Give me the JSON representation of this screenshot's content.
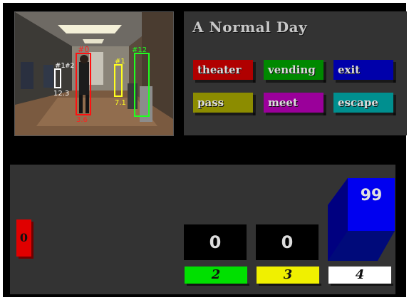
{
  "video": {
    "track_labels": [
      "#0",
      "#1",
      "#2",
      "#1",
      "#12",
      "12.3",
      "3.6",
      "7.1"
    ]
  },
  "title_panel": {
    "title": "A Normal Day",
    "buttons": [
      {
        "label": "theater",
        "color": "#b00000"
      },
      {
        "label": "vending",
        "color": "#008800"
      },
      {
        "label": "exit",
        "color": "#0000aa"
      },
      {
        "label": "pass",
        "color": "#8c8c00"
      },
      {
        "label": "meet",
        "color": "#9a009a"
      },
      {
        "label": "escape",
        "color": "#008f8f"
      }
    ]
  },
  "counters": {
    "red": {
      "value": "0",
      "color": "#e00000"
    },
    "boxes": [
      {
        "value": "0",
        "label": "2",
        "label_color": "#00e000"
      },
      {
        "value": "0",
        "label": "3",
        "label_color": "#f0f000"
      },
      {
        "label": "4",
        "label_color": "#ffffff"
      }
    ],
    "big": {
      "value": "99",
      "color": "#0000ee"
    }
  }
}
